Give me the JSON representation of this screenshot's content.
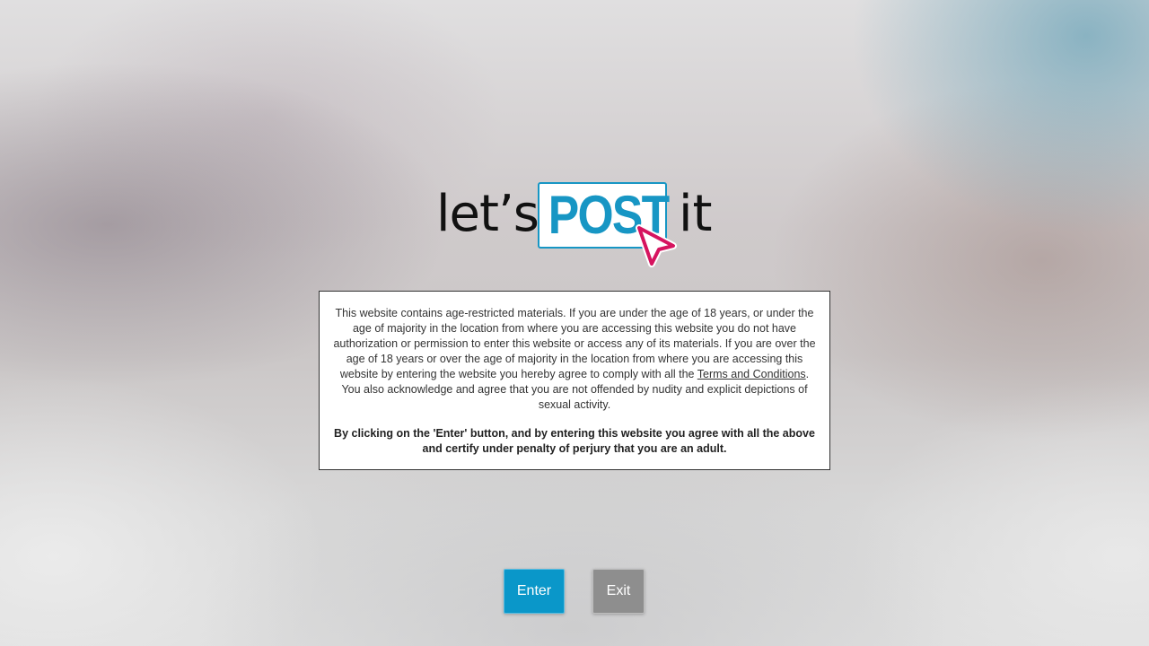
{
  "logo": {
    "lets": "let’s",
    "post": "POST",
    "it": "it",
    "colors": {
      "post_blue": "#1796c4",
      "cursor_pink": "#d6145f"
    },
    "icon": "cursor-arrow-icon"
  },
  "notice": {
    "paragraph_before_link": "This website contains age-restricted materials. If you are under the age of 18 years, or under the age of majority in the location from where you are accessing this website you do not have authorization or permission to enter this website or access any of its materials. If you are over the age of 18 years or over the age of majority in the location from where you are accessing this website by entering the website you hereby agree to comply with all the ",
    "terms_link": "Terms and Conditions",
    "paragraph_after_link": ". You also acknowledge and agree that you are not offended by nudity and explicit depictions of sexual activity.",
    "agreement": "By clicking on the 'Enter' button, and by entering this website you agree with all the above and certify under penalty of perjury that you are an adult."
  },
  "buttons": {
    "enter_label": "Enter",
    "exit_label": "Exit",
    "enter_color": "#0a97c9",
    "exit_color": "#8e8e8e"
  }
}
